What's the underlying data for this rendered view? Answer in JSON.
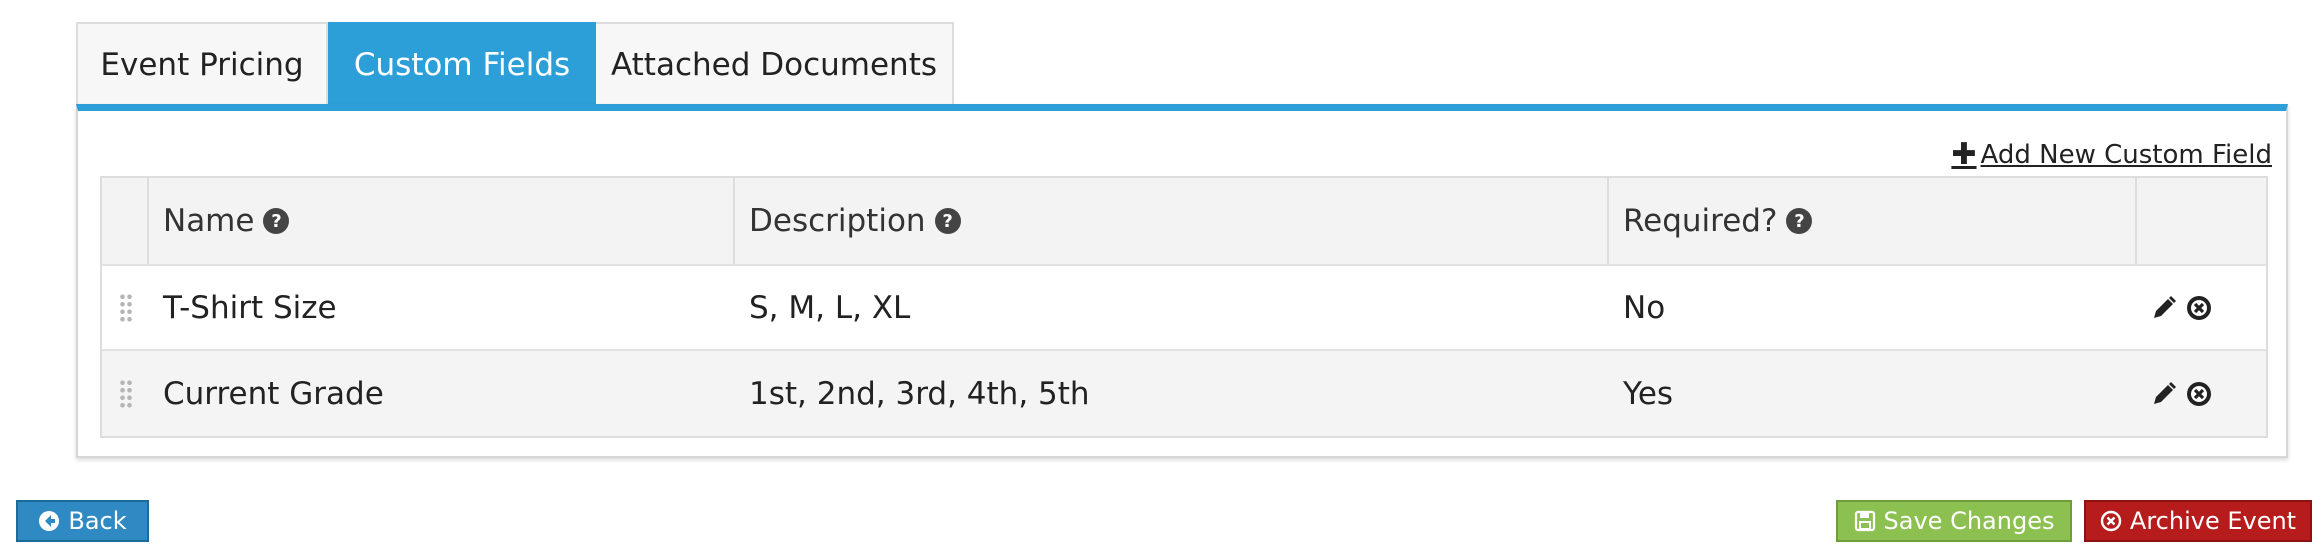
{
  "tabs": [
    {
      "label": "Event Pricing",
      "active": false
    },
    {
      "label": "Custom Fields",
      "active": true
    },
    {
      "label": "Attached Documents",
      "active": false
    }
  ],
  "add_link": "Add New Custom Field",
  "table": {
    "columns": [
      "Name",
      "Description",
      "Required?"
    ],
    "rows": [
      {
        "name": "T-Shirt Size",
        "description": "S, M, L, XL",
        "required": "No"
      },
      {
        "name": "Current Grade",
        "description": "1st, 2nd, 3rd, 4th, 5th",
        "required": "Yes"
      }
    ]
  },
  "buttons": {
    "back": "Back",
    "save": "Save Changes",
    "archive": "Archive Event"
  },
  "colors": {
    "accent": "#2d9fd8",
    "back": "#2f8ac4",
    "save": "#8cc152",
    "archive": "#b71c1c"
  },
  "icons": {
    "help": "question-circle-icon",
    "edit": "pencil-icon",
    "delete": "times-circle-icon",
    "drag": "drag-handle-icon",
    "add": "plus-icon",
    "back": "arrow-circle-left-icon",
    "save": "floppy-disk-icon",
    "archive": "times-circle-icon"
  }
}
